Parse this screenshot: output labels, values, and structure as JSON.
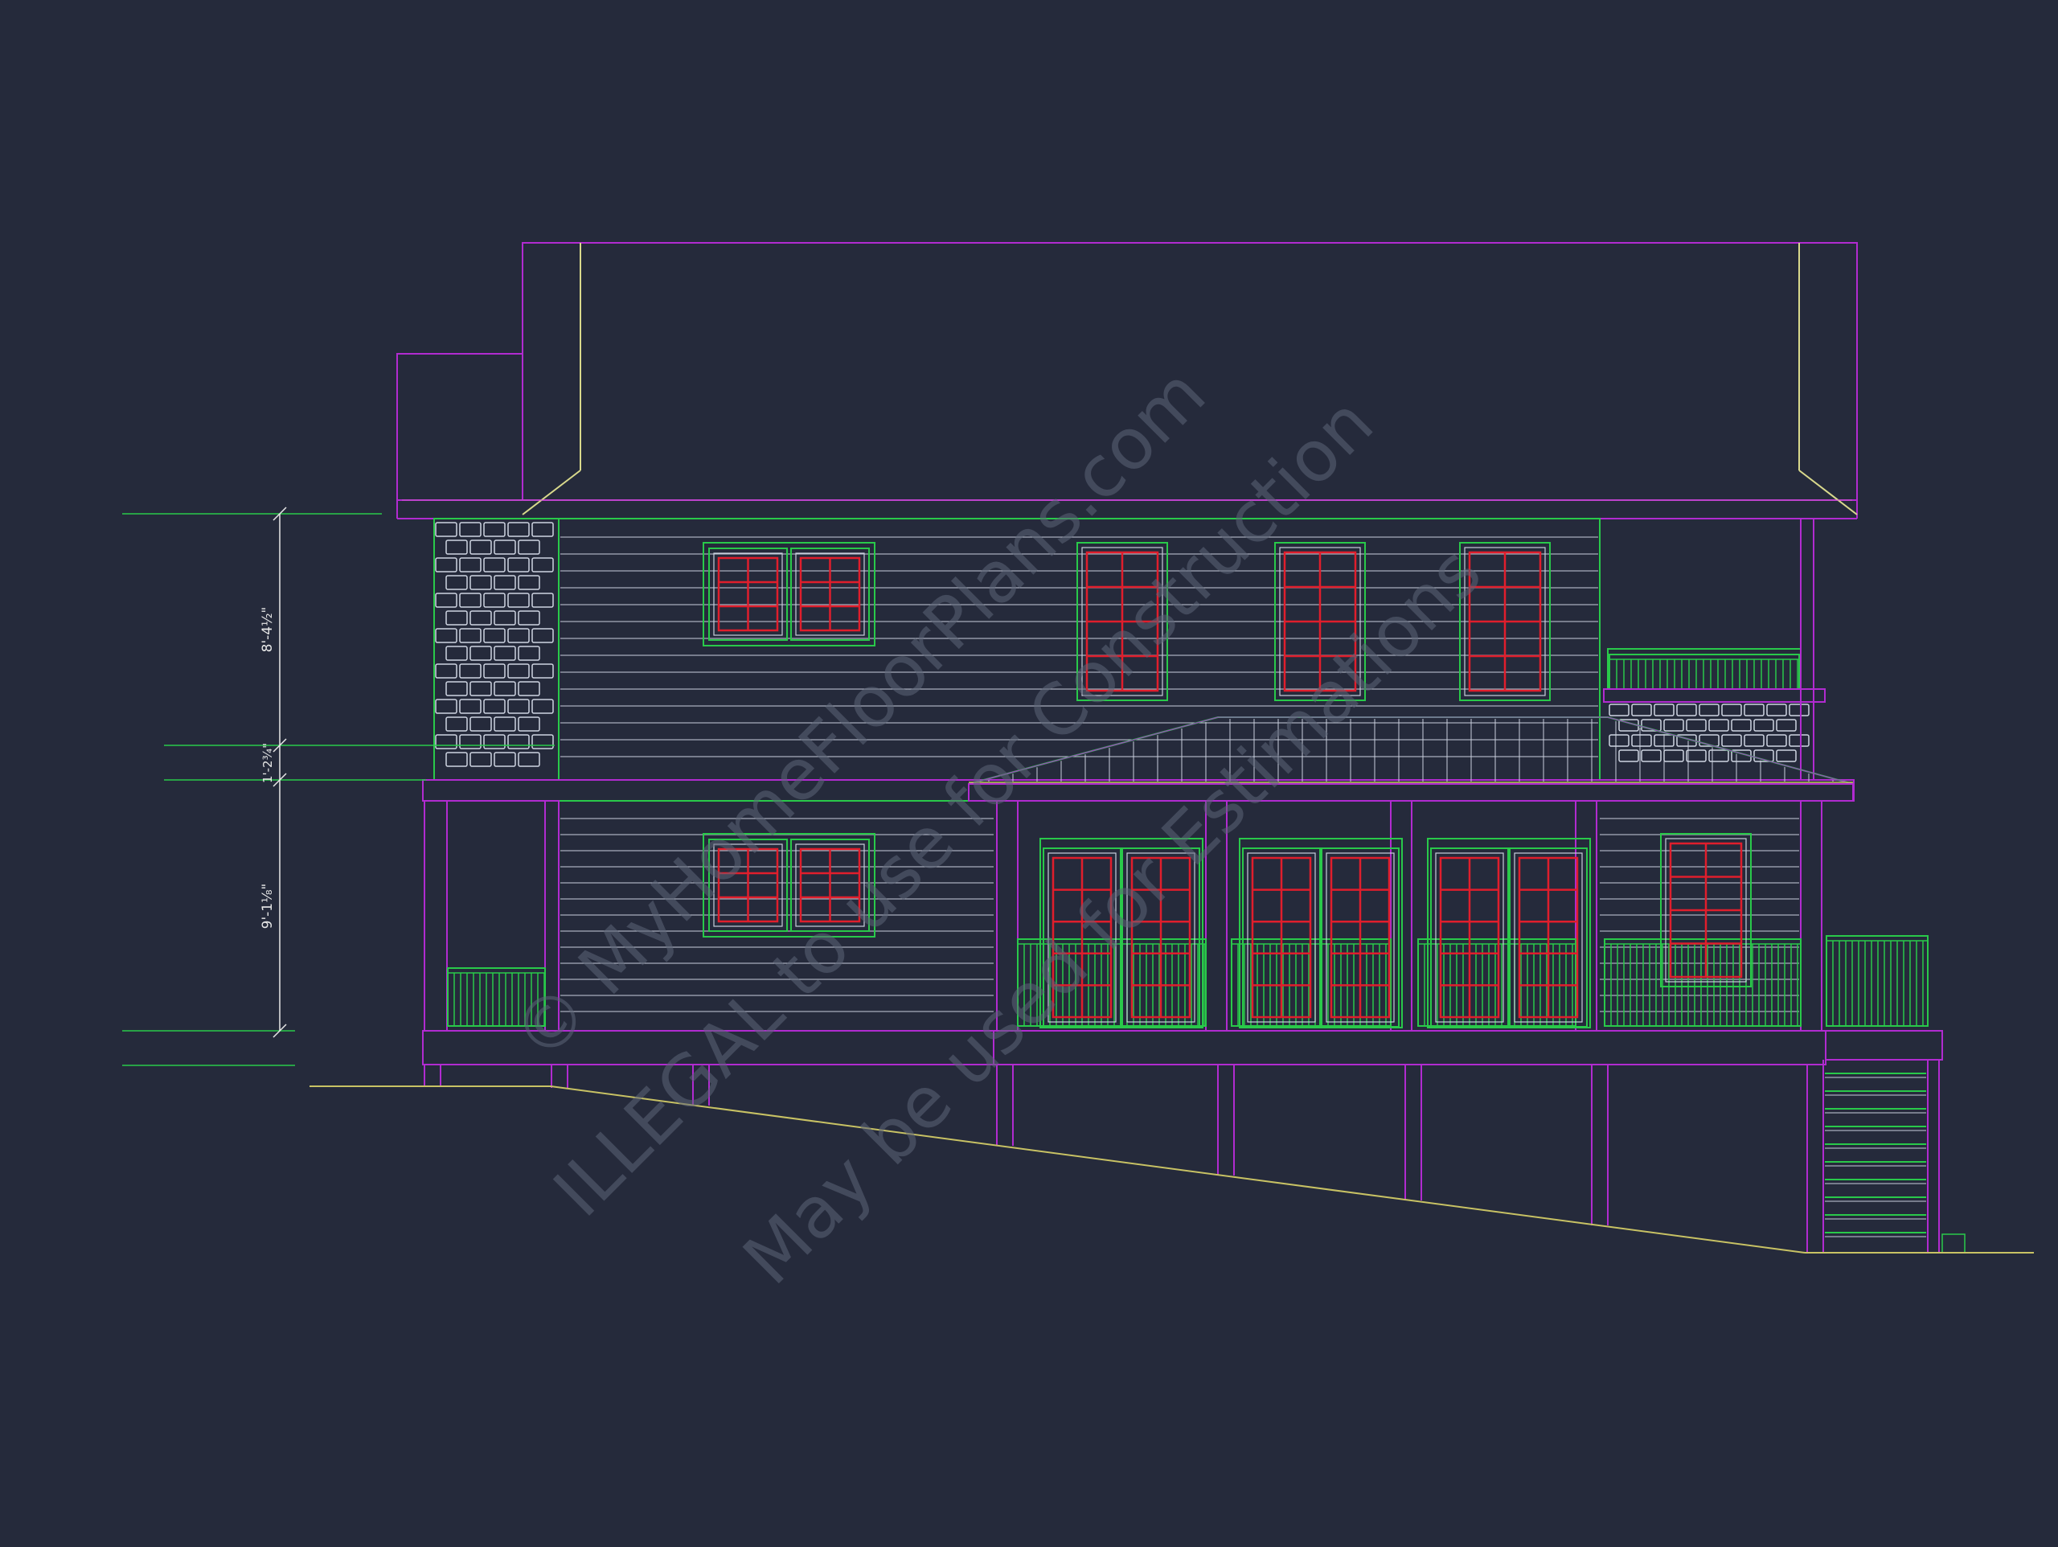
{
  "drawing": {
    "background": "#252a3b",
    "colors": {
      "roof_line": "#b12bd0",
      "hip_line": "#d9d98c",
      "trim_green": "#29c94a",
      "siding": "#c9cfdc",
      "window_red": "#e01e2c",
      "grade_line": "#c8c264",
      "dimension": "#e8e8e8",
      "stone": "#cfd5e2"
    }
  },
  "dimensions": {
    "upper_height": "8'-4½\"",
    "band_height": "1'-2¾\"",
    "lower_height": "9'-1⅛\""
  },
  "watermark": {
    "line1": "© MyHomeFloorPlans.com",
    "line2": "ILLEGAL to use for Construction",
    "line3": "May be used for Estimations"
  },
  "icons": [
    "dimension-tick-icon"
  ]
}
